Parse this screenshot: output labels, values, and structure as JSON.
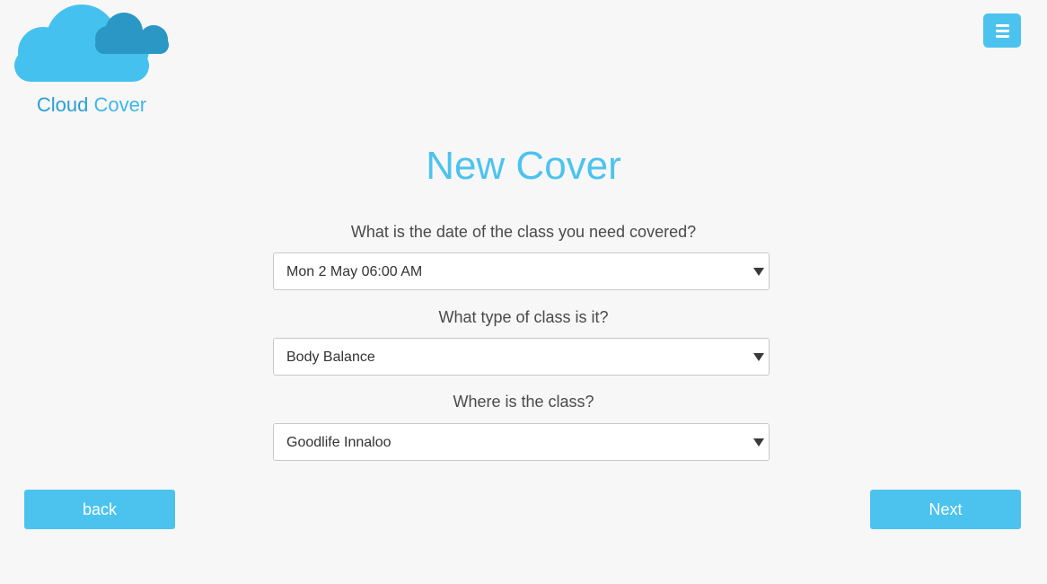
{
  "logo": {
    "word1": "Cloud",
    "word2": "Cover",
    "icon": "cloud-logo-icon",
    "colors": {
      "cloud_front": "#45c1ef",
      "cloud_back": "#2a97c4"
    }
  },
  "header": {
    "menu_icon": "hamburger-menu-icon"
  },
  "main": {
    "title": "New Cover",
    "fields": [
      {
        "question": "What is the date of the class you need covered?",
        "value": "Mon 2 May 06:00 AM"
      },
      {
        "question": "What type of class is it?",
        "value": "Body Balance"
      },
      {
        "question": "Where is the class?",
        "value": "Goodlife Innaloo"
      }
    ]
  },
  "footer": {
    "back_label": "back",
    "next_label": "Next"
  },
  "colors": {
    "accent": "#4cc3ef",
    "background": "#f7f7f7",
    "text": "#4a4a4a"
  }
}
